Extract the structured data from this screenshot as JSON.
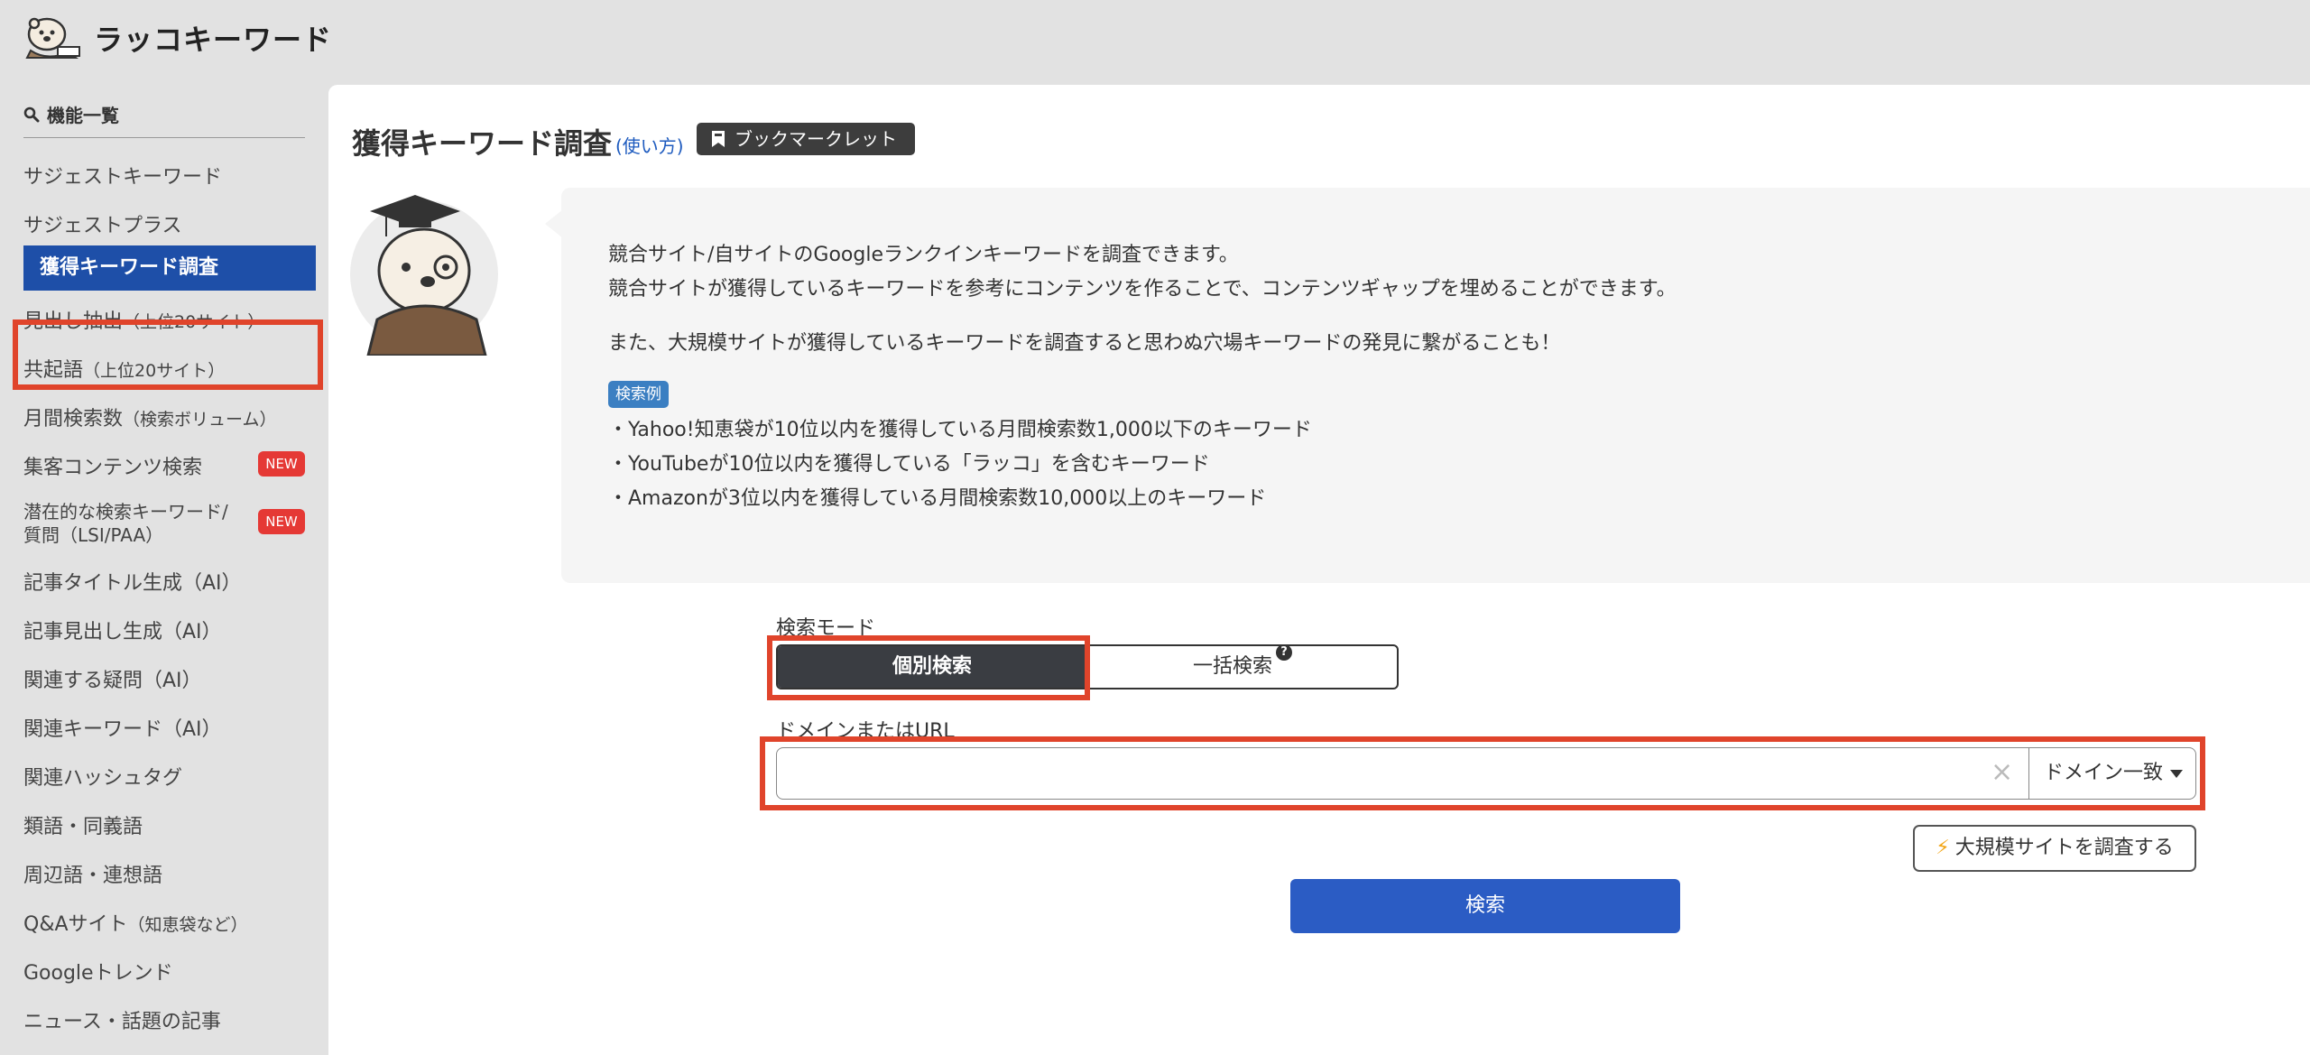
{
  "app": {
    "logo_text": "ラッコキーワード"
  },
  "sidebar": {
    "heading": "機能一覧",
    "items": [
      {
        "label": "サジェストキーワード"
      },
      {
        "label": "サジェストプラス"
      },
      {
        "label": "獲得キーワード調査",
        "active": true
      },
      {
        "label": "見出し抽出",
        "note": "（上位20サイト）"
      },
      {
        "label": "共起語",
        "note": "（上位20サイト）"
      },
      {
        "label": "月間検索数",
        "note": "（検索ボリューム）"
      },
      {
        "label": "集客コンテンツ検索",
        "badge": "NEW"
      },
      {
        "label": "潜在的な検索キーワード/",
        "label2": "質問（LSI/PAA）",
        "badge": "NEW"
      },
      {
        "label": "記事タイトル生成（AI）"
      },
      {
        "label": "記事見出し生成（AI）"
      },
      {
        "label": "関連する疑問（AI）"
      },
      {
        "label": "関連キーワード（AI）"
      },
      {
        "label": "関連ハッシュタグ"
      },
      {
        "label": "類語・同義語"
      },
      {
        "label": "周辺語・連想語"
      },
      {
        "label": "Q&Aサイト",
        "note": "（知恵袋など）"
      },
      {
        "label": "Googleトレンド"
      },
      {
        "label": "ニュース・話題の記事"
      }
    ]
  },
  "main": {
    "title": "獲得キーワード調査",
    "usage_link": "(使い方)",
    "bookmarklet_label": "ブックマークレット",
    "info": {
      "line1": "競合サイト/自サイトのGoogleランクインキーワードを調査できます。",
      "line2": "競合サイトが獲得しているキーワードを参考にコンテンツを作ることで、コンテンツギャップを埋めることができます。",
      "line3": "また、大規模サイトが獲得しているキーワードを調査すると思わぬ穴場キーワードの発見に繋がることも！",
      "example_badge": "検索例",
      "examples": [
        "・Yahoo!知恵袋が10位以内を獲得している月間検索数1,000以下のキーワード",
        "・YouTubeが10位以内を獲得している「ラッコ」を含むキーワード",
        "・Amazonが3位以内を獲得している月間検索数10,000以上のキーワード"
      ]
    },
    "mode_label": "検索モード",
    "mode_individual": "個別検索",
    "mode_bulk": "一括検索",
    "domain_label": "ドメインまたはURL",
    "domain_value": "",
    "domain_placeholder": "",
    "match_select": "ドメイン一致",
    "large_site_button": "大規模サイトを調査する",
    "search_button": "検索"
  },
  "colors": {
    "accent": "#1e4fa8",
    "search_button": "#2b5cc4",
    "highlight": "#e0442b",
    "new_badge": "#e53935"
  }
}
